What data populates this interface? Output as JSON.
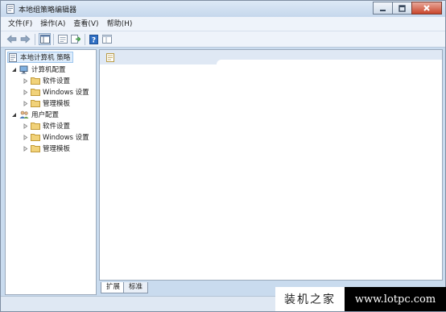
{
  "window": {
    "title": "本地组策略编辑器"
  },
  "menubar": {
    "items": [
      {
        "label": "文件(F)"
      },
      {
        "label": "操作(A)"
      },
      {
        "label": "查看(V)"
      },
      {
        "label": "帮助(H)"
      }
    ]
  },
  "toolbar": {
    "icons": [
      "back-arrow-icon",
      "forward-arrow-icon",
      "show-hide-tree-icon",
      "properties-icon",
      "export-list-icon",
      "help-icon",
      "extended-view-icon"
    ]
  },
  "tree": {
    "root": {
      "label": "本地计算机 策略"
    },
    "computer_config": {
      "label": "计算机配置",
      "children": [
        {
          "label": "软件设置"
        },
        {
          "label": "Windows 设置"
        },
        {
          "label": "管理模板"
        }
      ]
    },
    "user_config": {
      "label": "用户配置",
      "children": [
        {
          "label": "软件设置"
        },
        {
          "label": "Windows 设置"
        },
        {
          "label": "管理模板"
        }
      ]
    }
  },
  "tabs": [
    {
      "label": "扩展",
      "active": true
    },
    {
      "label": "标准",
      "active": false
    }
  ],
  "watermark": {
    "left_text": "装机之家",
    "right_text": "www.lotpc.com"
  },
  "colors": {
    "frame": "#c9dbee",
    "selection": "#ddecfb",
    "folder": "#f1d27a"
  }
}
